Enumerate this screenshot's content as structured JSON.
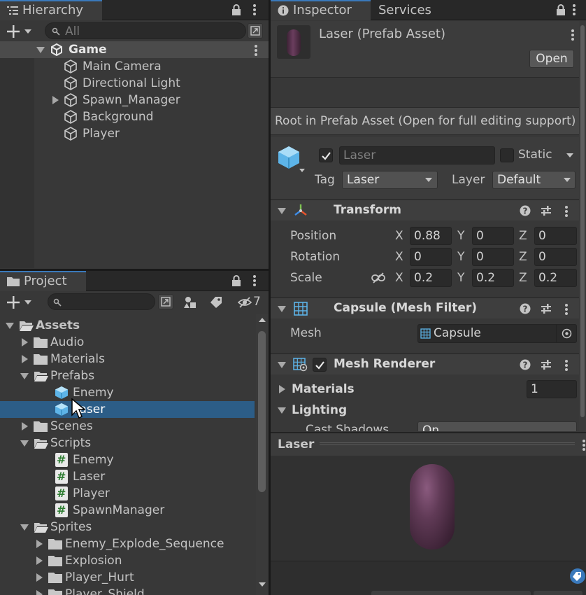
{
  "hierarchy": {
    "tab_label": "Hierarchy",
    "search_placeholder": "All",
    "scene_name": "Game",
    "items": [
      {
        "label": "Main Camera",
        "expandable": false
      },
      {
        "label": "Directional Light",
        "expandable": false
      },
      {
        "label": "Spawn_Manager",
        "expandable": true
      },
      {
        "label": "Background",
        "expandable": false
      },
      {
        "label": "Player",
        "expandable": false
      }
    ]
  },
  "project": {
    "tab_label": "Project",
    "hidden_count": "7",
    "tree": [
      {
        "label": "Assets",
        "kind": "folder-open",
        "depth": 0,
        "expanded": true,
        "bold": true
      },
      {
        "label": "Audio",
        "kind": "folder",
        "depth": 1,
        "expanded": false
      },
      {
        "label": "Materials",
        "kind": "folder",
        "depth": 1,
        "expanded": false
      },
      {
        "label": "Prefabs",
        "kind": "folder-open",
        "depth": 1,
        "expanded": true
      },
      {
        "label": "Enemy",
        "kind": "prefab",
        "depth": 2
      },
      {
        "label": "Laser",
        "kind": "prefab",
        "depth": 2,
        "selected": true
      },
      {
        "label": "Scenes",
        "kind": "folder",
        "depth": 1,
        "expanded": false
      },
      {
        "label": "Scripts",
        "kind": "folder-open",
        "depth": 1,
        "expanded": true
      },
      {
        "label": "Enemy",
        "kind": "script",
        "depth": 2
      },
      {
        "label": "Laser",
        "kind": "script",
        "depth": 2
      },
      {
        "label": "Player",
        "kind": "script",
        "depth": 2
      },
      {
        "label": "SpawnManager",
        "kind": "script",
        "depth": 2
      },
      {
        "label": "Sprites",
        "kind": "folder-open",
        "depth": 1,
        "expanded": true
      },
      {
        "label": "Enemy_Explode_Sequence",
        "kind": "folder",
        "depth": 2,
        "expanded": false
      },
      {
        "label": "Explosion",
        "kind": "folder",
        "depth": 2,
        "expanded": false
      },
      {
        "label": "Player_Hurt",
        "kind": "folder",
        "depth": 2,
        "expanded": false
      },
      {
        "label": "Player_Shield",
        "kind": "folder",
        "depth": 2,
        "expanded": false
      }
    ]
  },
  "inspector": {
    "tab_label": "Inspector",
    "services_tab": "Services",
    "asset_title": "Laser (Prefab Asset)",
    "open_button": "Open",
    "info_text": "Root in Prefab Asset (Open for full editing support)",
    "object_name": "Laser",
    "static_label": "Static",
    "tag_label": "Tag",
    "tag_value": "Laser",
    "layer_label": "Layer",
    "layer_value": "Default",
    "transform": {
      "title": "Transform",
      "position_label": "Position",
      "rotation_label": "Rotation",
      "scale_label": "Scale",
      "x_label": "X",
      "y_label": "Y",
      "z_label": "Z",
      "position": [
        "0.88",
        "0",
        "0"
      ],
      "rotation": [
        "0",
        "0",
        "0"
      ],
      "scale": [
        "0.2",
        "0.2",
        "0.2"
      ]
    },
    "mesh_filter": {
      "title": "Capsule (Mesh Filter)",
      "mesh_label": "Mesh",
      "mesh_value": "Capsule"
    },
    "mesh_renderer": {
      "title": "Mesh Renderer",
      "materials_label": "Materials",
      "materials_count": "1",
      "lighting_label": "Lighting",
      "cast_shadows_label": "Cast Shadows",
      "cast_shadows_value": "On"
    },
    "preview": {
      "title": "Laser"
    }
  },
  "colors": {
    "selection": "#2c5d87",
    "accent": "#3a79bb",
    "capsule": "#5a3550",
    "prefab_icon": "#5db4e8"
  }
}
